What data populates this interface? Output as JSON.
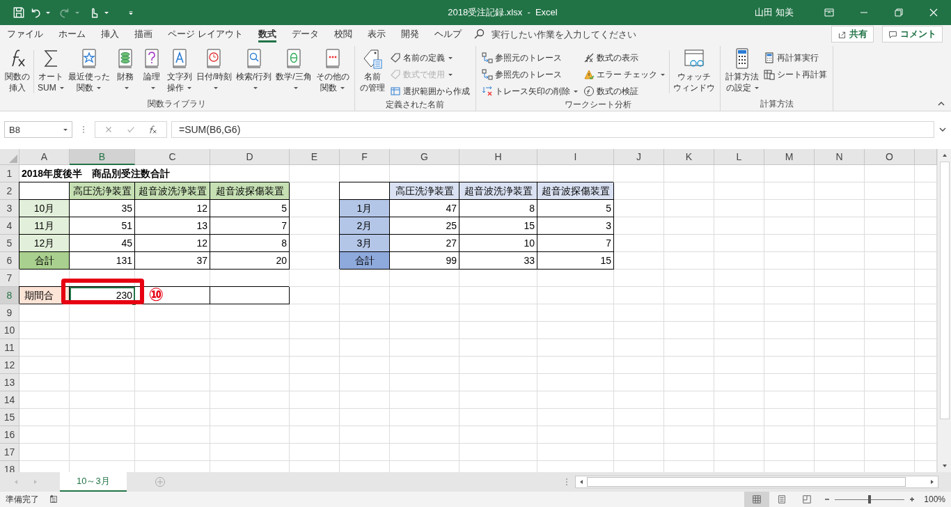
{
  "title_bar": {
    "title": "2018受注記録.xlsx  -  Excel",
    "user": "山田 知美",
    "redo_disabled": true
  },
  "menu_tabs": [
    {
      "label": "ファイル",
      "selected": false
    },
    {
      "label": "ホーム",
      "selected": false
    },
    {
      "label": "挿入",
      "selected": false
    },
    {
      "label": "描画",
      "selected": false
    },
    {
      "label": "ページ レイアウト",
      "selected": false
    },
    {
      "label": "数式",
      "selected": true
    },
    {
      "label": "データ",
      "selected": false
    },
    {
      "label": "校閲",
      "selected": false
    },
    {
      "label": "表示",
      "selected": false
    },
    {
      "label": "開発",
      "selected": false
    },
    {
      "label": "ヘルプ",
      "selected": false
    }
  ],
  "tell_me": {
    "placeholder": "実行したい作業を入力してください"
  },
  "share_button": "共有",
  "comment_button": "コメント",
  "ribbon": {
    "groups": [
      {
        "label": "関数ライブラリ",
        "items": [
          {
            "kind": "large",
            "lines": [
              "関数の",
              "挿入"
            ],
            "dropdown": false
          },
          {
            "kind": "large",
            "lines": [
              "オート",
              "SUM"
            ],
            "dropdown": true
          },
          {
            "kind": "large",
            "lines": [
              "最近使った",
              "関数"
            ],
            "dropdown": true
          },
          {
            "kind": "large",
            "lines": [
              "財務"
            ],
            "dropdown": true
          },
          {
            "kind": "large",
            "lines": [
              "論理"
            ],
            "dropdown": true
          },
          {
            "kind": "large",
            "lines": [
              "文字列",
              "操作"
            ],
            "dropdown": true
          },
          {
            "kind": "large",
            "lines": [
              "日付/時刻"
            ],
            "dropdown": true
          },
          {
            "kind": "large",
            "lines": [
              "検索/行列"
            ],
            "dropdown": true
          },
          {
            "kind": "large",
            "lines": [
              "数学/三角"
            ],
            "dropdown": true
          },
          {
            "kind": "large",
            "lines": [
              "その他の",
              "関数"
            ],
            "dropdown": true
          }
        ]
      },
      {
        "label": "定義された名前",
        "items": [
          {
            "kind": "large",
            "lines": [
              "名前",
              "の管理"
            ],
            "dropdown": false
          },
          {
            "kind": "column",
            "items": [
              {
                "label": "名前の定義",
                "dropdown": true,
                "disabled": false
              },
              {
                "label": "数式で使用",
                "dropdown": true,
                "disabled": true
              },
              {
                "label": "選択範囲から作成",
                "dropdown": false,
                "disabled": false
              }
            ]
          }
        ]
      },
      {
        "label": "ワークシート分析",
        "items": [
          {
            "kind": "column",
            "items": [
              {
                "label": "参照元のトレース",
                "dropdown": false,
                "disabled": false
              },
              {
                "label": "参照先のトレース",
                "dropdown": false,
                "disabled": false
              },
              {
                "label": "トレース矢印の削除",
                "dropdown": true,
                "disabled": false
              }
            ]
          },
          {
            "kind": "column",
            "items": [
              {
                "label": "数式の表示",
                "dropdown": false,
                "disabled": false
              },
              {
                "label": "エラー チェック",
                "dropdown": true,
                "disabled": false
              },
              {
                "label": "数式の検証",
                "dropdown": false,
                "disabled": false
              }
            ]
          },
          {
            "kind": "large",
            "lines": [
              "ウォッチ",
              "ウィンドウ"
            ],
            "dropdown": false
          }
        ]
      },
      {
        "label": "計算方法",
        "items": [
          {
            "kind": "large",
            "lines": [
              "計算方法",
              "の設定"
            ],
            "dropdown": true
          },
          {
            "kind": "column",
            "items": [
              {
                "label": "再計算実行",
                "dropdown": false,
                "disabled": false
              },
              {
                "label": "シート再計算",
                "dropdown": false,
                "disabled": false
              }
            ]
          }
        ]
      }
    ]
  },
  "formula_bar": {
    "name_box": "B8",
    "formula": "=SUM(B6,G6)"
  },
  "sheet": {
    "columns": [
      {
        "label": "A",
        "selected": false
      },
      {
        "label": "B",
        "selected": true
      },
      {
        "label": "C",
        "selected": false
      },
      {
        "label": "D",
        "selected": false
      },
      {
        "label": "E",
        "selected": false
      },
      {
        "label": "F",
        "selected": false
      },
      {
        "label": "G",
        "selected": false
      },
      {
        "label": "H",
        "selected": false
      },
      {
        "label": "I",
        "selected": false
      },
      {
        "label": "J",
        "selected": false
      },
      {
        "label": "K",
        "selected": false
      },
      {
        "label": "L",
        "selected": false
      },
      {
        "label": "M",
        "selected": false
      },
      {
        "label": "N",
        "selected": false
      },
      {
        "label": "O",
        "selected": false
      }
    ],
    "rows": [
      {
        "number": "1",
        "selected": false,
        "cells": [
          {
            "text": "2018年度後半　商品別受注数合計",
            "kind": "title",
            "selected": false
          }
        ]
      },
      {
        "number": "2",
        "selected": false,
        "cells": [
          {
            "kind": "blank",
            "selected": false
          },
          {
            "text": "高圧洗浄装置",
            "kind": "head-green",
            "selected": false
          },
          {
            "text": "超音波洗浄装置",
            "kind": "head-green",
            "selected": false
          },
          {
            "text": "超音波探傷装置",
            "kind": "head-green",
            "selected": false
          },
          null,
          {
            "kind": "blank",
            "selected": false
          },
          {
            "text": "高圧洗浄装置",
            "kind": "head-blue",
            "selected": false
          },
          {
            "text": "超音波洗浄装置",
            "kind": "head-blue",
            "selected": false
          },
          {
            "text": "超音波探傷装置",
            "kind": "head-blue",
            "selected": false
          }
        ]
      },
      {
        "number": "3",
        "selected": false,
        "cells": [
          {
            "text": "10月",
            "kind": "label-green",
            "selected": false
          },
          {
            "text": "35",
            "kind": "number",
            "selected": false
          },
          {
            "text": "12",
            "kind": "number",
            "selected": false
          },
          {
            "text": "5",
            "kind": "number",
            "selected": false
          },
          null,
          {
            "text": "1月",
            "kind": "label-blue",
            "selected": false
          },
          {
            "text": "47",
            "kind": "number",
            "selected": false
          },
          {
            "text": "8",
            "kind": "number",
            "selected": false
          },
          {
            "text": "5",
            "kind": "number",
            "selected": false
          }
        ]
      },
      {
        "number": "4",
        "selected": false,
        "cells": [
          {
            "text": "11月",
            "kind": "label-green",
            "selected": false
          },
          {
            "text": "51",
            "kind": "number",
            "selected": false
          },
          {
            "text": "13",
            "kind": "number",
            "selected": false
          },
          {
            "text": "7",
            "kind": "number",
            "selected": false
          },
          null,
          {
            "text": "2月",
            "kind": "label-blue",
            "selected": false
          },
          {
            "text": "25",
            "kind": "number",
            "selected": false
          },
          {
            "text": "15",
            "kind": "number",
            "selected": false
          },
          {
            "text": "3",
            "kind": "number",
            "selected": false
          }
        ]
      },
      {
        "number": "5",
        "selected": false,
        "cells": [
          {
            "text": "12月",
            "kind": "label-green",
            "selected": false
          },
          {
            "text": "45",
            "kind": "number",
            "selected": false
          },
          {
            "text": "12",
            "kind": "number",
            "selected": false
          },
          {
            "text": "8",
            "kind": "number",
            "selected": false
          },
          null,
          {
            "text": "3月",
            "kind": "label-blue",
            "selected": false
          },
          {
            "text": "27",
            "kind": "number",
            "selected": false
          },
          {
            "text": "10",
            "kind": "number",
            "selected": false
          },
          {
            "text": "7",
            "kind": "number",
            "selected": false
          }
        ]
      },
      {
        "number": "6",
        "selected": false,
        "cells": [
          {
            "text": "合計",
            "kind": "total-green",
            "selected": false
          },
          {
            "text": "131",
            "kind": "number",
            "selected": false
          },
          {
            "text": "37",
            "kind": "number",
            "selected": false
          },
          {
            "text": "20",
            "kind": "number",
            "selected": false
          },
          null,
          {
            "text": "合計",
            "kind": "total-blue",
            "selected": false
          },
          {
            "text": "99",
            "kind": "number",
            "selected": false
          },
          {
            "text": "33",
            "kind": "number",
            "selected": false
          },
          {
            "text": "15",
            "kind": "number",
            "selected": false
          }
        ]
      },
      {
        "number": "7",
        "selected": false
      },
      {
        "number": "8",
        "selected": true,
        "cells": [
          {
            "text": "期間合",
            "kind": "label-orange",
            "selected": false
          },
          {
            "text": "230",
            "kind": "number",
            "selected": true,
            "callout": "⑩"
          },
          {
            "kind": "blank",
            "selected": false
          },
          {
            "kind": "blank",
            "selected": false
          }
        ]
      },
      {
        "number": "9",
        "selected": false
      },
      {
        "number": "10",
        "selected": false
      },
      {
        "number": "11",
        "selected": false
      },
      {
        "number": "12",
        "selected": false
      },
      {
        "number": "13",
        "selected": false
      },
      {
        "number": "14",
        "selected": false
      },
      {
        "number": "15",
        "selected": false
      },
      {
        "number": "16",
        "selected": false
      },
      {
        "number": "17",
        "selected": false
      },
      {
        "number": "18",
        "selected": false
      }
    ]
  },
  "sheet_tabs": [
    {
      "label": "10～3月",
      "selected": true
    }
  ],
  "status_bar": {
    "status": "準備完了",
    "zoom": {
      "level": 0.5,
      "reading": "100%"
    }
  }
}
